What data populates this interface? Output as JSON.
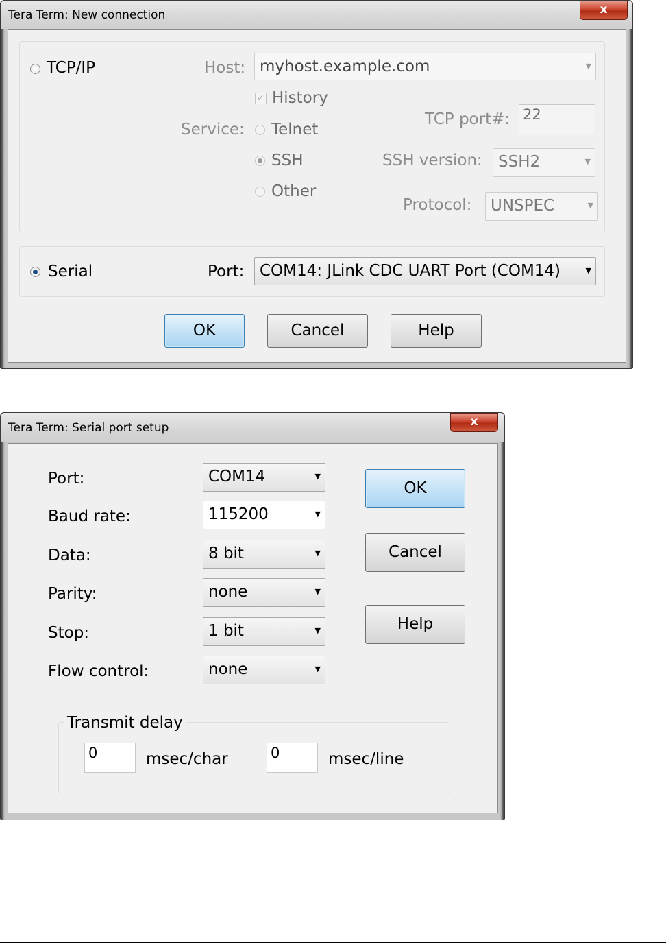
{
  "dialog1": {
    "title": "Tera Term: New connection",
    "close": "x",
    "tcpip": {
      "radio_label": "TCP/IP",
      "host_label": "Host:",
      "host_value": "myhost.example.com",
      "history_label": "History",
      "service_label": "Service:",
      "telnet_label": "Telnet",
      "ssh_label": "SSH",
      "other_label": "Other",
      "tcp_port_label": "TCP port#:",
      "tcp_port_value": "22",
      "ssh_version_label": "SSH version:",
      "ssh_version_value": "SSH2",
      "protocol_label": "Protocol:",
      "protocol_value": "UNSPEC"
    },
    "serial": {
      "radio_label": "Serial",
      "port_label": "Port:",
      "port_value": "COM14: JLink CDC UART Port (COM14)"
    },
    "buttons": {
      "ok": "OK",
      "cancel": "Cancel",
      "help": "Help"
    }
  },
  "dialog2": {
    "title": "Tera Term: Serial port setup",
    "close": "x",
    "fields": [
      {
        "label": "Port:",
        "value": "COM14"
      },
      {
        "label": "Baud rate:",
        "value": "115200"
      },
      {
        "label": "Data:",
        "value": "8 bit"
      },
      {
        "label": "Parity:",
        "value": "none"
      },
      {
        "label": "Stop:",
        "value": "1 bit"
      },
      {
        "label": "Flow control:",
        "value": "none"
      }
    ],
    "transmit_delay": {
      "title": "Transmit delay",
      "char_value": "0",
      "char_label": "msec/char",
      "line_value": "0",
      "line_label": "msec/line"
    },
    "buttons": {
      "ok": "OK",
      "cancel": "Cancel",
      "help": "Help"
    }
  }
}
